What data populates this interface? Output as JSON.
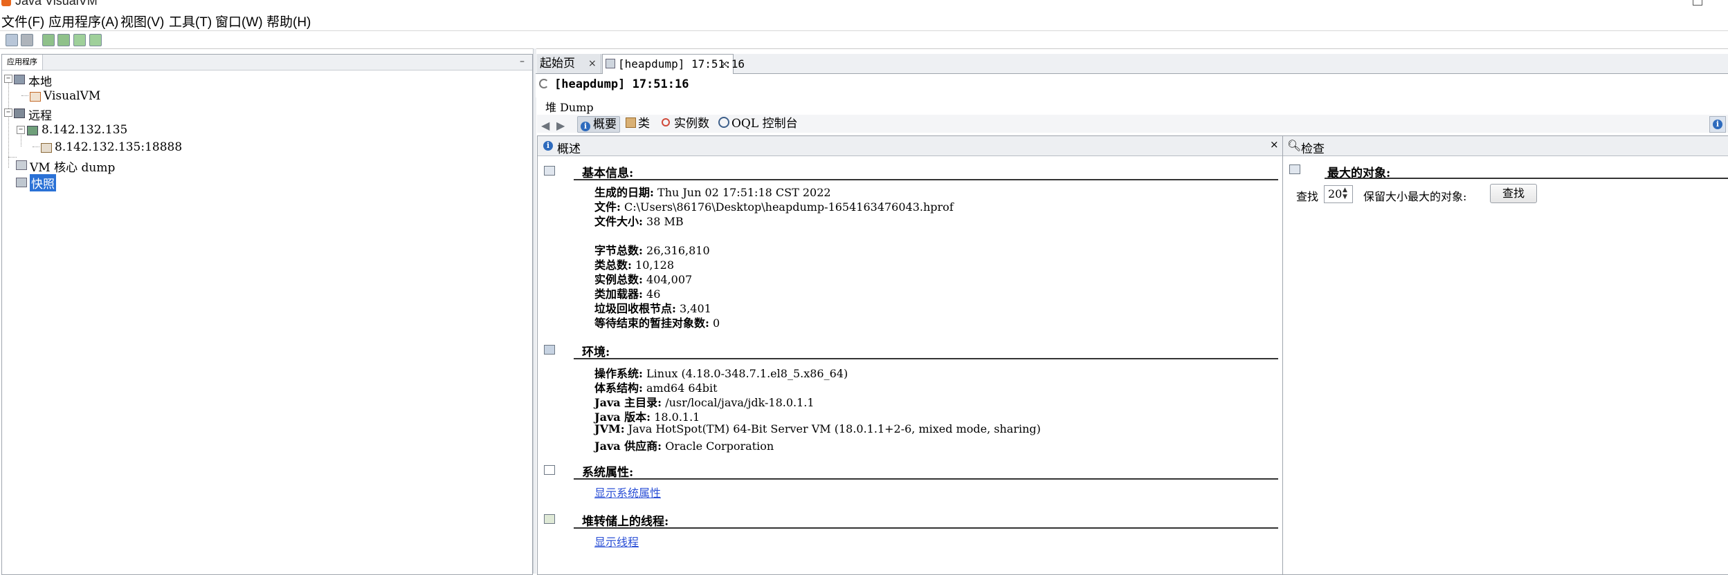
{
  "window": {
    "title": "Java VisualVM"
  },
  "menu": [
    "文件(F)",
    "应用程序(A)",
    "视图(V)",
    "工具(T)",
    "窗口(W)",
    "帮助(H)"
  ],
  "left_panel": {
    "tab_label": "应用程序",
    "minimize_glyph": "–",
    "tree": {
      "local": "本地",
      "visualvm": "VisualVM",
      "remote": "远程",
      "host": "8.142.132.135",
      "jmx": "8.142.132.135:18888",
      "core_dump": "VM 核心 dump",
      "snapshots": "快照"
    }
  },
  "doc_tabs": [
    {
      "label": "起始页",
      "close": "×"
    },
    {
      "label": "[heapdump] 17:51:16",
      "close": "×"
    }
  ],
  "doc": {
    "title": "[heapdump] 17:51:16",
    "subtitle": "堆 Dump",
    "views": [
      "概要",
      "类",
      "实例数",
      "OQL 控制台"
    ]
  },
  "summary": {
    "panel_title": "概述",
    "close": "×",
    "basic": {
      "title": "基本信息:",
      "lines": [
        {
          "label": "生成的日期:",
          "value": "Thu Jun 02 17:51:18 CST 2022"
        },
        {
          "label": "文件:",
          "value": "C:\\Users\\86176\\Desktop\\heapdump-1654163476043.hprof"
        },
        {
          "label": "文件大小:",
          "value": "38 MB"
        },
        {
          "label": "字节总数:",
          "value": "26,316,810"
        },
        {
          "label": "类总数:",
          "value": "10,128"
        },
        {
          "label": "实例总数:",
          "value": "404,007"
        },
        {
          "label": "类加载器:",
          "value": "46"
        },
        {
          "label": "垃圾回收根节点:",
          "value": "3,401"
        },
        {
          "label": "等待结束的暂挂对象数:",
          "value": "0"
        }
      ]
    },
    "env": {
      "title": "环境:",
      "lines": [
        {
          "label": "操作系统:",
          "value": "Linux (4.18.0-348.7.1.el8_5.x86_64)"
        },
        {
          "label": "体系结构:",
          "value": "amd64 64bit"
        },
        {
          "label": "Java 主目录:",
          "value": "/usr/local/java/jdk-18.0.1.1"
        },
        {
          "label": "Java 版本:",
          "value": "18.0.1.1"
        },
        {
          "label": "JVM:",
          "value": "Java HotSpot(TM) 64-Bit Server VM (18.0.1.1+2-6, mixed mode, sharing)"
        },
        {
          "label": "Java 供应商:",
          "value": "Oracle Corporation"
        }
      ]
    },
    "sysprops": {
      "title": "系统属性:",
      "link": "显示系统属性"
    },
    "threads": {
      "title": "堆转储上的线程:",
      "link": "显示线程"
    }
  },
  "inspect": {
    "panel_title": "检查",
    "section_title": "最大的对象:",
    "find_label": "查找",
    "count": "20",
    "after_label": "保留大小最大的对象:",
    "button": "查找"
  }
}
